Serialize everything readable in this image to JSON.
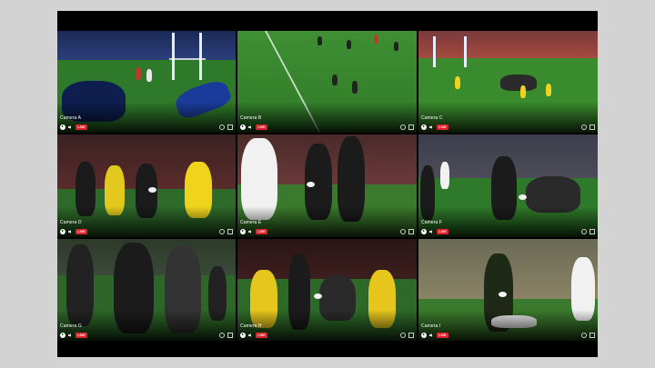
{
  "cameras": [
    {
      "label": "Camera A",
      "live": "LIVE"
    },
    {
      "label": "Camera B",
      "live": "LIVE"
    },
    {
      "label": "Camera C",
      "live": "LIVE"
    },
    {
      "label": "Camera D",
      "live": "LIVE"
    },
    {
      "label": "Camera E",
      "live": "LIVE"
    },
    {
      "label": "Camera F",
      "live": "LIVE"
    },
    {
      "label": "Camera G",
      "live": "LIVE"
    },
    {
      "label": "Camera H",
      "live": "LIVE"
    },
    {
      "label": "Camera I",
      "live": "LIVE"
    }
  ],
  "icons": {
    "play": "play-icon",
    "volume": "volume-icon",
    "settings": "gear-icon",
    "fullscreen": "fullscreen-icon"
  },
  "colors": {
    "live_badge": "#e0202a",
    "background": "#d3d3d3",
    "frame": "#000000"
  }
}
